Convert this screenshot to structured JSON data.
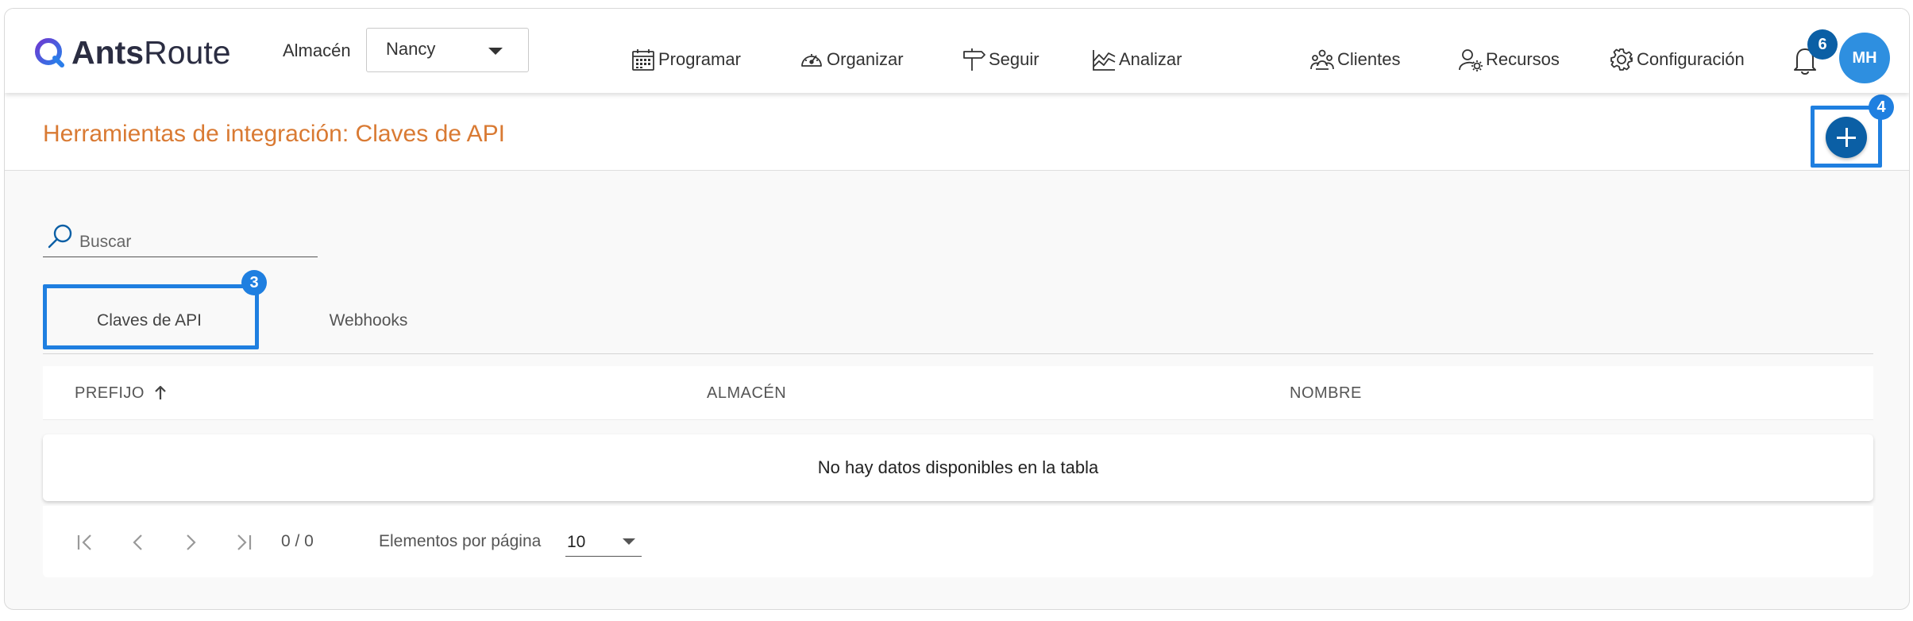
{
  "brand": {
    "bold": "Ants",
    "light": "Route"
  },
  "header": {
    "store_label": "Almacén",
    "store_value": "Nancy",
    "nav": [
      {
        "label": "Programar",
        "icon": "calendar-icon"
      },
      {
        "label": "Organizar",
        "icon": "gauge-icon"
      },
      {
        "label": "Seguir",
        "icon": "signpost-icon"
      },
      {
        "label": "Analizar",
        "icon": "chart-icon"
      },
      {
        "label": "Clientes",
        "icon": "people-icon"
      },
      {
        "label": "Recursos",
        "icon": "user-gear-icon"
      },
      {
        "label": "Configuración",
        "icon": "gear-icon"
      }
    ],
    "notifications_count": "6",
    "user_initials": "MH"
  },
  "page": {
    "title": "Herramientas de integración: Claves de API",
    "add_badge": "4"
  },
  "search": {
    "placeholder": "Buscar"
  },
  "tabs": [
    {
      "label": "Claves de API",
      "badge": "3",
      "active": true
    },
    {
      "label": "Webhooks",
      "active": false
    }
  ],
  "table": {
    "columns": [
      "PREFIJO",
      "ALMACÉN",
      "NOMBRE"
    ],
    "empty_message": "No hay datos disponibles en la tabla"
  },
  "pagination": {
    "range": "0 / 0",
    "per_page_label": "Elementos por página",
    "per_page_value": "10"
  },
  "colors": {
    "title": "#d97a33",
    "primary": "#0b5fa5",
    "highlight": "#1f7fe0",
    "avatar": "#2e8fe0"
  }
}
